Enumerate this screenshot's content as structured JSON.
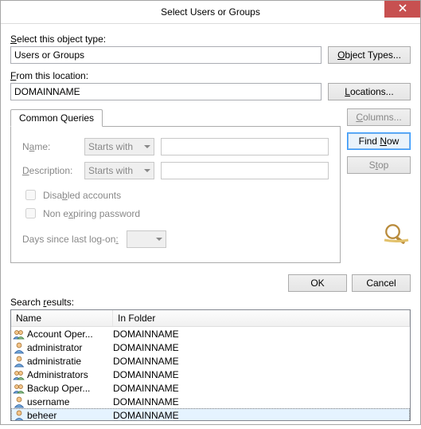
{
  "window": {
    "title": "Select Users or Groups",
    "close_tooltip": "Close"
  },
  "object_type": {
    "label": "Select this object type:",
    "value": "Users or Groups",
    "button": "Object Types..."
  },
  "location": {
    "label": "From this location:",
    "value": "DOMAINNAME",
    "button": "Locations..."
  },
  "tab_label": "Common Queries",
  "queries": {
    "name_label": "Name:",
    "name_mode": "Starts with",
    "name_value": "",
    "desc_label": "Description:",
    "desc_mode": "Starts with",
    "desc_value": "",
    "disabled_label": "Disabled accounts",
    "nonexpiring_label": "Non expiring password",
    "logon_label": "Days since last log-on:",
    "logon_value": ""
  },
  "side": {
    "columns": "Columns...",
    "find_now": "Find Now",
    "stop": "Stop"
  },
  "ok_label": "OK",
  "cancel_label": "Cancel",
  "results_label": "Search results:",
  "columns": {
    "name": "Name",
    "folder": "In Folder"
  },
  "results": [
    {
      "icon": "group",
      "name": "Account Oper...",
      "folder": "DOMAINNAME",
      "selected": false
    },
    {
      "icon": "user",
      "name": "administrator",
      "folder": "DOMAINNAME",
      "selected": false
    },
    {
      "icon": "user",
      "name": "administratie",
      "folder": "DOMAINNAME",
      "selected": false
    },
    {
      "icon": "group",
      "name": "Administrators",
      "folder": "DOMAINNAME",
      "selected": false
    },
    {
      "icon": "group",
      "name": "Backup Oper...",
      "folder": "DOMAINNAME",
      "selected": false
    },
    {
      "icon": "user",
      "name": "username",
      "folder": "DOMAINNAME",
      "selected": false
    },
    {
      "icon": "user",
      "name": "beheer",
      "folder": "DOMAINNAME",
      "selected": true
    }
  ]
}
